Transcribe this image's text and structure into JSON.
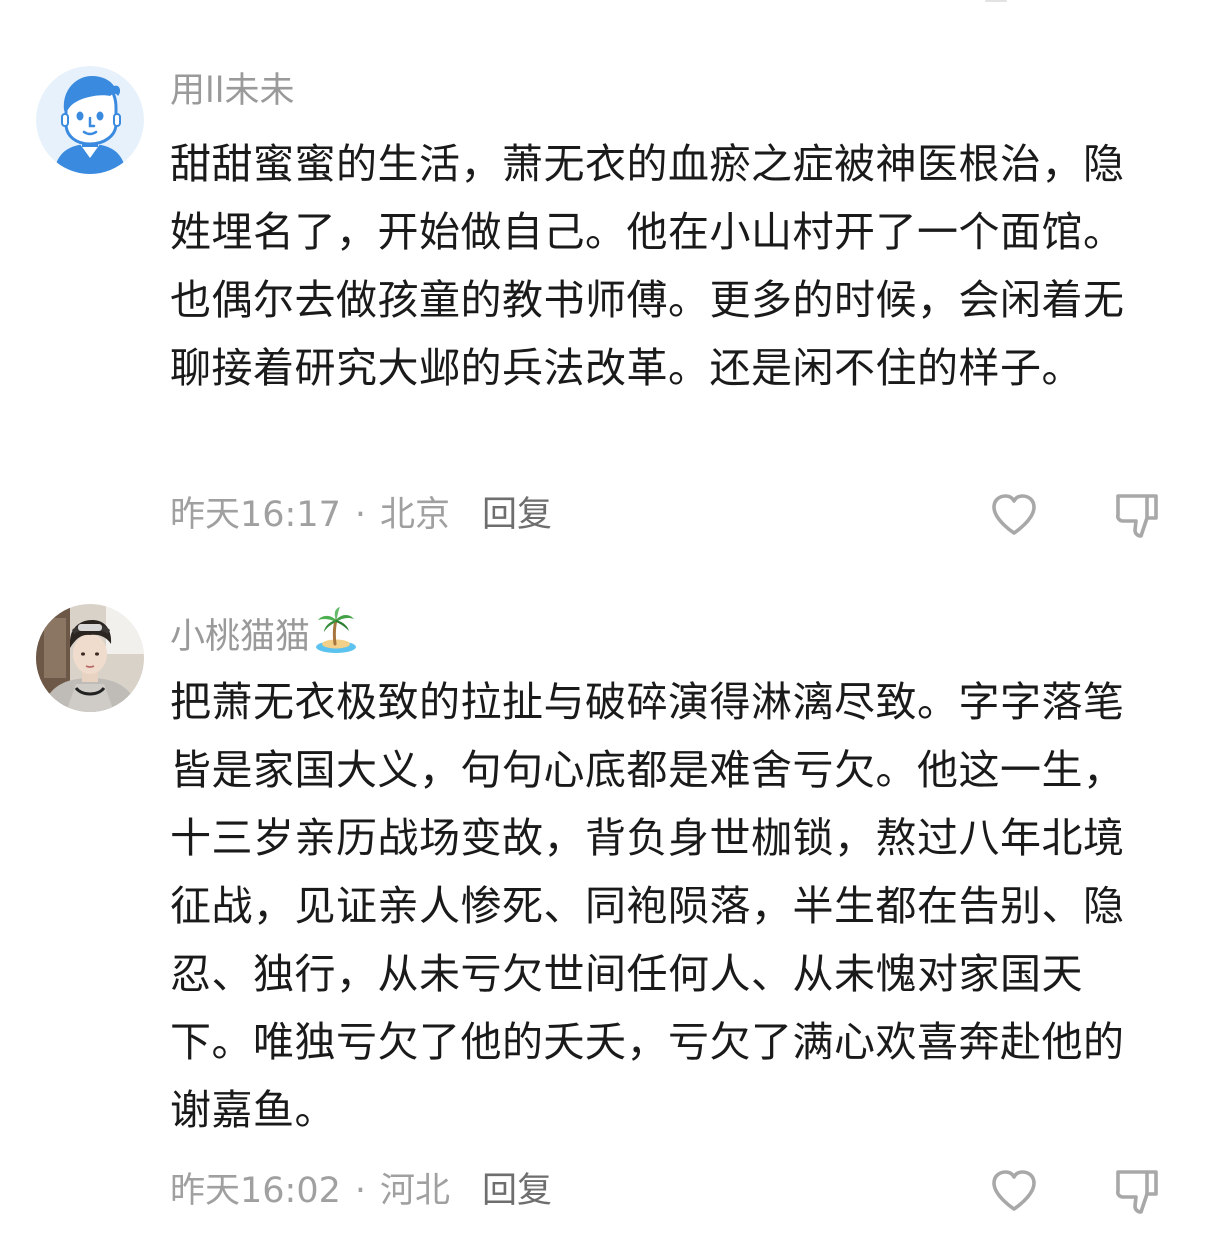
{
  "comments": [
    {
      "username": "用ll未未",
      "avatar": "cartoon-boy-avatar",
      "text": "甜甜蜜蜜的生活，萧无衣的血瘀之症被神医根治，隐姓埋名了，开始做自己。他在小山村开了一个面馆。也偶尔去做孩童的教书师傅。更多的时候，会闲着无聊接着研究大邺的兵法改革。还是闲不住的样子。",
      "time": "昨天16:17",
      "separator": "·",
      "location": "北京",
      "reply_label": "回复",
      "like_icon": "heart-outline-icon",
      "dislike_icon": "thumbs-down-icon"
    },
    {
      "username": "小桃猫猫",
      "username_badge": "desert-island-emoji",
      "avatar": "photo-avatar",
      "text": "把萧无衣极致的拉扯与破碎演得淋漓尽致。字字落笔皆是家国大义，句句心底都是难舍亏欠。他这一生，十三岁亲历战场变故，背负身世枷锁，熬过八年北境征战，见证亲人惨死、同袍陨落，半生都在告别、隐忍、独行，从未亏欠世间任何人、从未愧对家国天下。唯独亏欠了他的夭夭，亏欠了满心欢喜奔赴他的谢嘉鱼。",
      "time": "昨天16:02",
      "separator": "·",
      "location": "河北",
      "reply_label": "回复",
      "like_icon": "heart-outline-icon",
      "dislike_icon": "thumbs-down-icon"
    }
  ],
  "colors": {
    "username": "#9a9a9a",
    "body_text": "#1a1a1a",
    "meta_text": "#a0a0a0",
    "reply_text": "#6e6e6e",
    "icon_stroke": "#a8a8a8"
  }
}
